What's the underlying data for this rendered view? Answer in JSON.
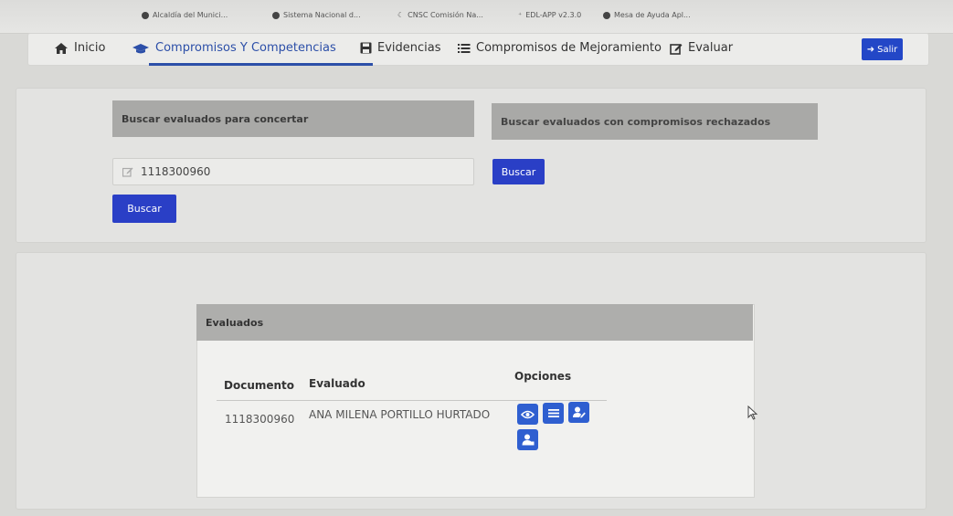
{
  "bookmarks": [
    "Alcaldía del Munici...",
    "Sistema Nacional d...",
    "CNSC Comisión Na...",
    "EDL-APP v2.3.0",
    "Mesa de Ayuda Apl..."
  ],
  "nav": {
    "inicio": "Inicio",
    "compromisos": "Compromisos Y Competencias",
    "evidencias": "Evidencias",
    "mejoramiento": "Compromisos de Mejoramiento",
    "evaluar": "Evaluar",
    "salir": "Salir"
  },
  "search_concertar": {
    "header": "Buscar evaluados para concertar",
    "input_value": "1118300960",
    "button": "Buscar"
  },
  "search_rechazados": {
    "header": "Buscar evaluados con compromisos rechazados",
    "button": "Buscar"
  },
  "evaluados": {
    "header": "Evaluados",
    "columns": [
      "Documento",
      "Evaluado",
      "Opciones"
    ],
    "rows": [
      {
        "documento": "1118300960",
        "evaluado": "ANA MILENA PORTILLO HURTADO"
      }
    ]
  },
  "colors": {
    "accent": "#2c4fa8",
    "button": "#2a3fc6",
    "option_button": "#2f5fd0"
  }
}
